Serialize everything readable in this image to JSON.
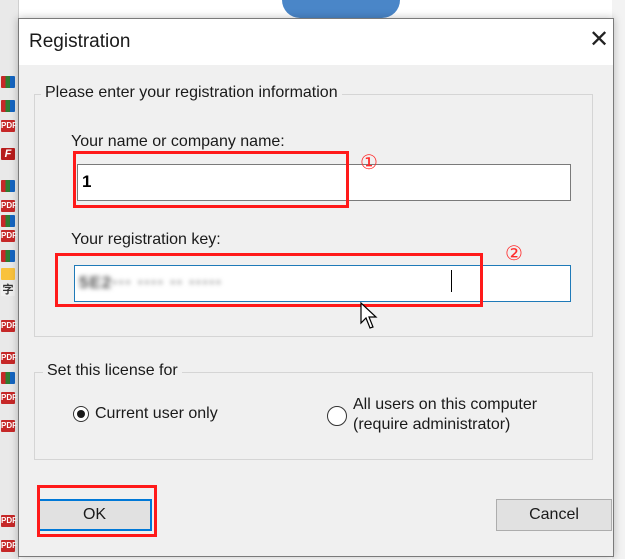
{
  "window": {
    "title": "Registration",
    "close_glyph": "✕"
  },
  "info_group": {
    "legend": "Please enter your registration information",
    "name_label": "Your name or company name:",
    "name_value": "1",
    "key_label": "Your registration key:",
    "key_value": "5E2··· ···· ·· ·····",
    "key_blurred": true
  },
  "license_group": {
    "legend": "Set this license for",
    "options": [
      {
        "label": "Current user only",
        "checked": true
      },
      {
        "label": "All users on this computer\n(require administrator)",
        "checked": false
      }
    ]
  },
  "buttons": {
    "ok": "OK",
    "cancel": "Cancel"
  },
  "annotations": {
    "marker_1": "①",
    "marker_2": "②",
    "color": "#ff1a1a"
  },
  "background": {
    "bottom_text": "Pd"
  },
  "icons": [
    "close-icon",
    "cursor-icon",
    "pdf-file-icon"
  ]
}
